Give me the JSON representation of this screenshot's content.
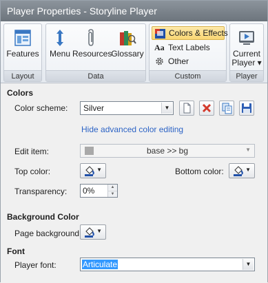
{
  "window": {
    "title": "Player Properties - Storyline Player"
  },
  "ribbon": {
    "groups": {
      "layout": {
        "label": "Layout",
        "features_label": "Features"
      },
      "data": {
        "label": "Data",
        "menu_label": "Menu",
        "resources_label": "Resources",
        "glossary_label": "Glossary"
      },
      "custom": {
        "label": "Custom",
        "colors_effects_label": "Colors & Effects",
        "text_labels_label": "Text Labels",
        "other_label": "Other"
      },
      "player": {
        "label": "Player",
        "current_player_label_line1": "Current",
        "current_player_label_line2": "Player ▾"
      }
    }
  },
  "colors": {
    "heading": "Colors",
    "color_scheme_label": "Color scheme:",
    "color_scheme_value": "Silver",
    "hide_advanced_link": "Hide advanced color editing",
    "edit_item_label": "Edit item:",
    "edit_item_value": "base >> bg",
    "top_color_label": "Top color:",
    "bottom_color_label": "Bottom color:",
    "transparency_label": "Transparency:",
    "transparency_value": "0%"
  },
  "background": {
    "heading": "Background Color",
    "page_background_label": "Page background:"
  },
  "font": {
    "heading": "Font",
    "player_font_label": "Player font:",
    "player_font_value": "Articulate"
  },
  "icons": [
    "features-icon",
    "menu-icon",
    "resources-icon",
    "glossary-icon",
    "colors-effects-icon",
    "text-labels-icon",
    "other-gear-icon",
    "current-player-icon",
    "new-scheme-icon",
    "delete-scheme-icon",
    "copy-scheme-icon",
    "save-scheme-icon",
    "paint-bucket-icon",
    "chevron-down-icon"
  ],
  "accent_colors": {
    "link": "#2c63c5",
    "active_button": "#f9d774",
    "selection": "#3399ff",
    "delete_red": "#d33a2c"
  }
}
